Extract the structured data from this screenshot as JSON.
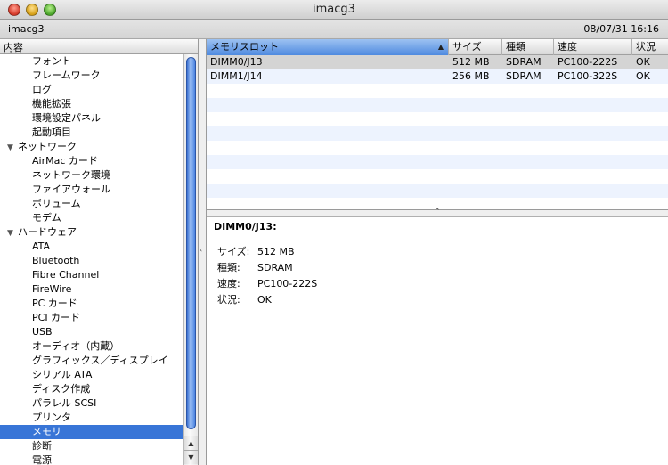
{
  "window": {
    "title": "imacg3"
  },
  "infobar": {
    "host": "imacg3",
    "date": "08/07/31 16:16"
  },
  "sidebar": {
    "header": "内容",
    "items": [
      {
        "label": "フォント",
        "level": 1
      },
      {
        "label": "フレームワーク",
        "level": 1
      },
      {
        "label": "ログ",
        "level": 1
      },
      {
        "label": "機能拡張",
        "level": 1
      },
      {
        "label": "環境設定パネル",
        "level": 1
      },
      {
        "label": "起動項目",
        "level": 1
      },
      {
        "label": "ネットワーク",
        "level": 0
      },
      {
        "label": "AirMac カード",
        "level": 1
      },
      {
        "label": "ネットワーク環境",
        "level": 1
      },
      {
        "label": "ファイアウォール",
        "level": 1
      },
      {
        "label": "ボリューム",
        "level": 1
      },
      {
        "label": "モデム",
        "level": 1
      },
      {
        "label": "ハードウェア",
        "level": 0
      },
      {
        "label": "ATA",
        "level": 1
      },
      {
        "label": "Bluetooth",
        "level": 1
      },
      {
        "label": "Fibre Channel",
        "level": 1
      },
      {
        "label": "FireWire",
        "level": 1
      },
      {
        "label": "PC カード",
        "level": 1
      },
      {
        "label": "PCI カード",
        "level": 1
      },
      {
        "label": "USB",
        "level": 1
      },
      {
        "label": "オーディオ（内蔵）",
        "level": 1
      },
      {
        "label": "グラフィックス／ディスプレイ",
        "level": 1
      },
      {
        "label": "シリアル ATA",
        "level": 1
      },
      {
        "label": "ディスク作成",
        "level": 1
      },
      {
        "label": "パラレル SCSI",
        "level": 1
      },
      {
        "label": "プリンタ",
        "level": 1
      },
      {
        "label": "メモリ",
        "level": 1,
        "selected": true
      },
      {
        "label": "診断",
        "level": 1
      },
      {
        "label": "電源",
        "level": 1
      }
    ]
  },
  "table": {
    "columns": [
      "メモリスロット",
      "サイズ",
      "種類",
      "速度",
      "状況"
    ],
    "rows": [
      [
        "DIMM0/J13",
        "512 MB",
        "SDRAM",
        "PC100-222S",
        "OK"
      ],
      [
        "DIMM1/J14",
        "256 MB",
        "SDRAM",
        "PC100-322S",
        "OK"
      ]
    ]
  },
  "detail": {
    "title": "DIMM0/J13:",
    "fields": [
      {
        "key": "サイズ:",
        "value": "512 MB"
      },
      {
        "key": "種類:",
        "value": "SDRAM"
      },
      {
        "key": "速度:",
        "value": "PC100-222S"
      },
      {
        "key": "状況:",
        "value": "OK"
      }
    ]
  },
  "colors": {
    "selection": "#3875d7",
    "row_alt": "#edf3fe"
  }
}
